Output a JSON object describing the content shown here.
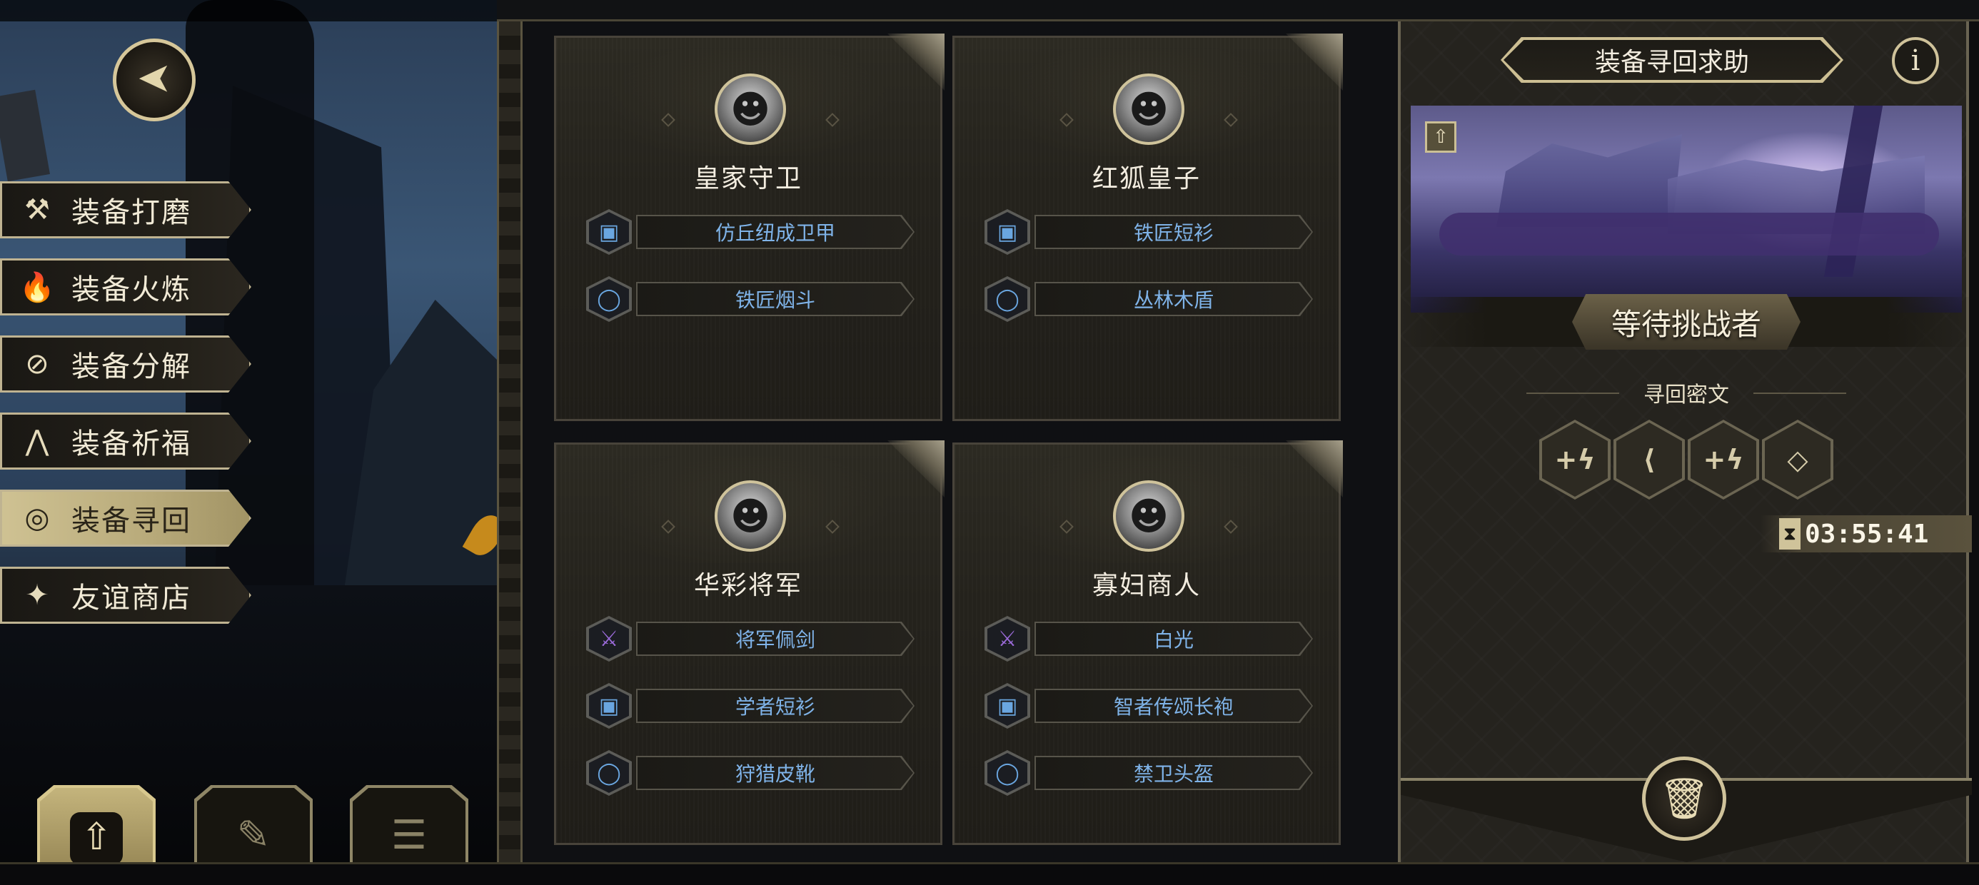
{
  "menu": {
    "items": [
      {
        "label": "装备打磨",
        "icon": "hammer-icon",
        "glyph": "⚒",
        "active": false
      },
      {
        "label": "装备火炼",
        "icon": "flame-icon",
        "glyph": "🔥",
        "active": false
      },
      {
        "label": "装备分解",
        "icon": "shatter-icon",
        "glyph": "⊘",
        "active": false
      },
      {
        "label": "装备祈福",
        "icon": "pray-icon",
        "glyph": "⋀",
        "active": false
      },
      {
        "label": "装备寻回",
        "icon": "target-icon",
        "glyph": "◎",
        "active": true
      },
      {
        "label": "友谊商店",
        "icon": "fox-icon",
        "glyph": "✦",
        "active": false
      }
    ]
  },
  "bottom_tabs": [
    {
      "icon": "upload-doc-icon",
      "glyph": "⇧",
      "active": true
    },
    {
      "icon": "feather-icon",
      "glyph": "✎",
      "active": false
    },
    {
      "icon": "list-icon",
      "glyph": "☰",
      "active": false
    }
  ],
  "cards": [
    {
      "name": "皇家守卫",
      "portrait": "☻",
      "items": [
        {
          "label": "仿丘纽成卫甲",
          "icon": "armor-icon",
          "glyph": "▣",
          "color": "#6aa6e0"
        },
        {
          "label": "铁匠烟斗",
          "icon": "ring-icon",
          "glyph": "◯",
          "color": "#6aa6e0"
        }
      ]
    },
    {
      "name": "红狐皇子",
      "portrait": "☻",
      "items": [
        {
          "label": "铁匠短衫",
          "icon": "armor-icon",
          "glyph": "▣",
          "color": "#6aa6e0"
        },
        {
          "label": "丛林木盾",
          "icon": "ring-icon",
          "glyph": "◯",
          "color": "#6aa6e0"
        }
      ]
    },
    {
      "name": "华彩将军",
      "portrait": "☻",
      "items": [
        {
          "label": "将军佩剑",
          "icon": "sword-icon",
          "glyph": "⚔",
          "color": "#9a6ad8"
        },
        {
          "label": "学者短衫",
          "icon": "armor-icon",
          "glyph": "▣",
          "color": "#6aa6e0"
        },
        {
          "label": "狩猎皮靴",
          "icon": "ring-icon",
          "glyph": "◯",
          "color": "#6aa6e0"
        }
      ]
    },
    {
      "name": "寡妇商人",
      "portrait": "☻",
      "items": [
        {
          "label": "白光",
          "icon": "sword-icon",
          "glyph": "⚔",
          "color": "#9a6ad8"
        },
        {
          "label": "智者传颂长袍",
          "icon": "armor-icon",
          "glyph": "▣",
          "color": "#6aa6e0"
        },
        {
          "label": "禁卫头盔",
          "icon": "ring-icon",
          "glyph": "◯",
          "color": "#6aa6e0"
        }
      ]
    }
  ],
  "right_panel": {
    "title": "装备寻回求助",
    "info_glyph": "i",
    "status": "等待挑战者",
    "cipher_label": "寻回密文",
    "runes": [
      "+ϟ",
      "⟨",
      "+ϟ",
      "◇"
    ],
    "timer": "03:55:41",
    "delete_glyph": "🗑"
  },
  "back_glyph": "➤"
}
